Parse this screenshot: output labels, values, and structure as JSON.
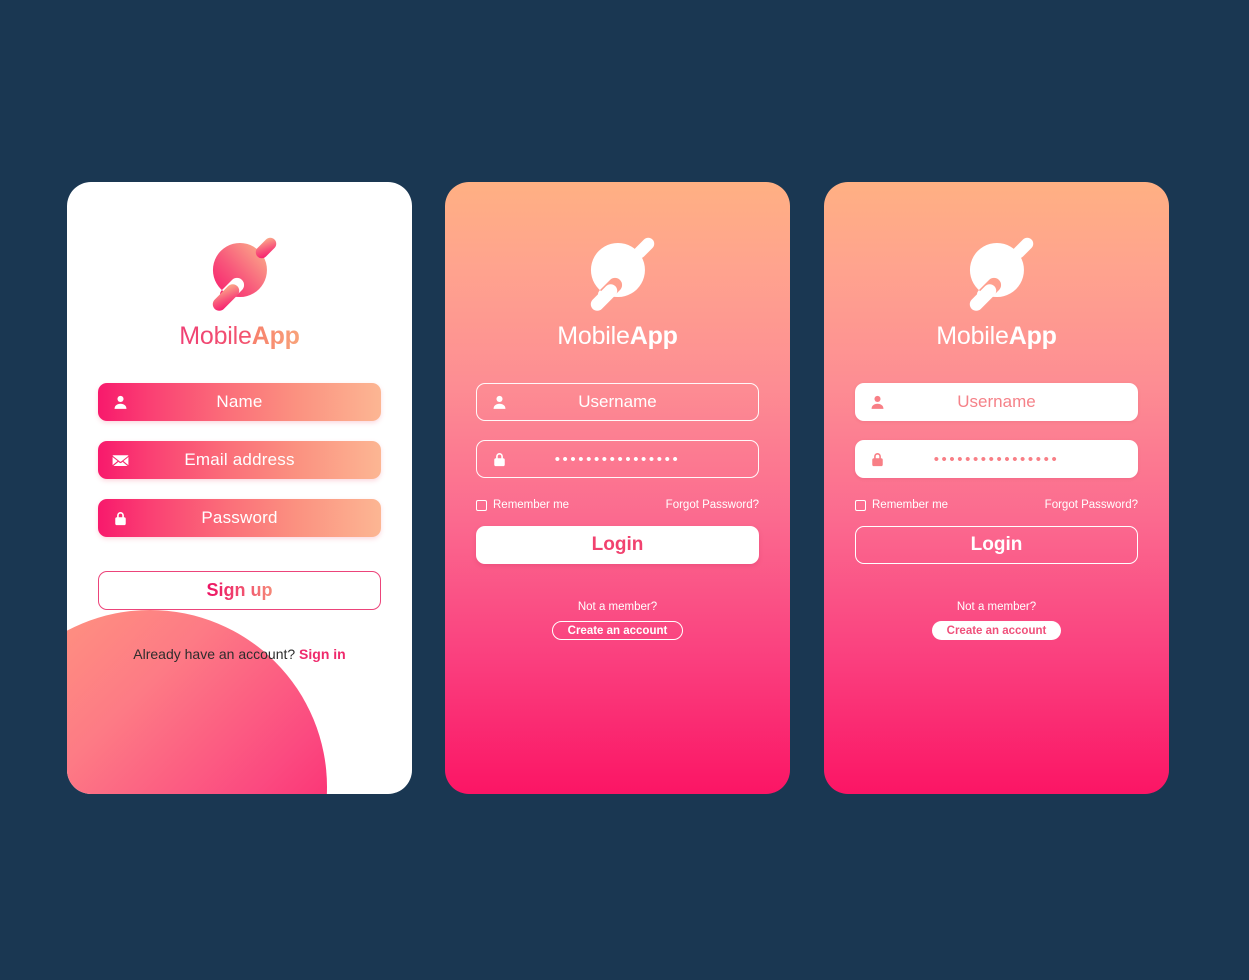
{
  "theme": {
    "page_background": "#1a3752",
    "gradient_start": "#ffb083",
    "gradient_end": "#fb1565",
    "accent_pink": "#ef2a6c",
    "accent_peach": "#f8a37a",
    "white": "#ffffff"
  },
  "brand": {
    "name_light": "Mobile",
    "name_bold": "App",
    "logo_icon": "planet-ring-icon"
  },
  "signup_screen": {
    "fields": [
      {
        "icon": "user-icon",
        "label": "Name"
      },
      {
        "icon": "mail-icon",
        "label": "Email address"
      },
      {
        "icon": "lock-icon",
        "label": "Password"
      }
    ],
    "submit_label": "Sign up",
    "footer_text": "Already have an account?",
    "footer_link": "Sign in"
  },
  "login_screen_outline": {
    "fields": [
      {
        "icon": "user-icon",
        "label": "Username",
        "type": "text"
      },
      {
        "icon": "lock-icon",
        "value": "••••••••••••••••",
        "type": "password"
      }
    ],
    "remember_label": "Remember me",
    "remember_checked": false,
    "forgot_label": "Forgot Password?",
    "submit_label": "Login",
    "footer_text": "Not a member?",
    "footer_button": "Create an account"
  },
  "login_screen_filled": {
    "fields": [
      {
        "icon": "user-icon",
        "label": "Username",
        "type": "text"
      },
      {
        "icon": "lock-icon",
        "value": "••••••••••••••••",
        "type": "password"
      }
    ],
    "remember_label": "Remember me",
    "remember_checked": false,
    "forgot_label": "Forgot Password?",
    "submit_label": "Login",
    "footer_text": "Not a member?",
    "footer_button": "Create an account"
  }
}
